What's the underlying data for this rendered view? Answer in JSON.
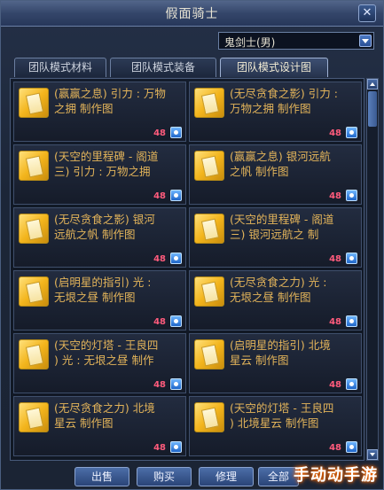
{
  "window": {
    "title": "假面骑士",
    "close_label": "✕"
  },
  "job_select": {
    "value": "鬼剑士(男)"
  },
  "tabs": [
    "团队模式材料",
    "团队模式装备",
    "团队模式设计图"
  ],
  "items": [
    {
      "name": "(赢赢之息) 引力 : 万物\n之拥 制作图",
      "cost": "48"
    },
    {
      "name": "(无尽贪食之影) 引力 :\n万物之拥 制作图",
      "cost": "48"
    },
    {
      "name": "(天空的里程碑 - 阁道\n三) 引力 : 万物之拥",
      "cost": "48"
    },
    {
      "name": "(赢赢之息) 银河远航\n之帆 制作图",
      "cost": "48"
    },
    {
      "name": "(无尽贪食之影) 银河\n远航之帆 制作图",
      "cost": "48"
    },
    {
      "name": "(天空的里程碑 - 阁道\n三) 银河远航之 制",
      "cost": "48"
    },
    {
      "name": "(启明星的指引) 光 :\n无垠之昼 制作图",
      "cost": "48"
    },
    {
      "name": "(无尽贪食之力) 光 :\n无垠之昼 制作图",
      "cost": "48"
    },
    {
      "name": "(天空的灯塔 - 王良四\n) 光 : 无垠之昼 制作",
      "cost": "48"
    },
    {
      "name": "(启明星的指引) 北境\n星云 制作图",
      "cost": "48"
    },
    {
      "name": "(无尽贪食之力) 北境\n星云 制作图",
      "cost": "48"
    },
    {
      "name": "(天空的灯塔 - 王良四\n) 北境星云 制作图",
      "cost": "48"
    }
  ],
  "buttons": {
    "sell": "出售",
    "buy": "购买",
    "repair": "修理",
    "all": "全部"
  },
  "watermark": "手动动手游",
  "colors": {
    "item_name": "#e3b45a",
    "cost": "#ff5b7c",
    "title_bar": "#34466a"
  },
  "icons": [
    "close-icon",
    "dropdown-arrow-icon",
    "design-scroll-icon",
    "currency-icon"
  ]
}
